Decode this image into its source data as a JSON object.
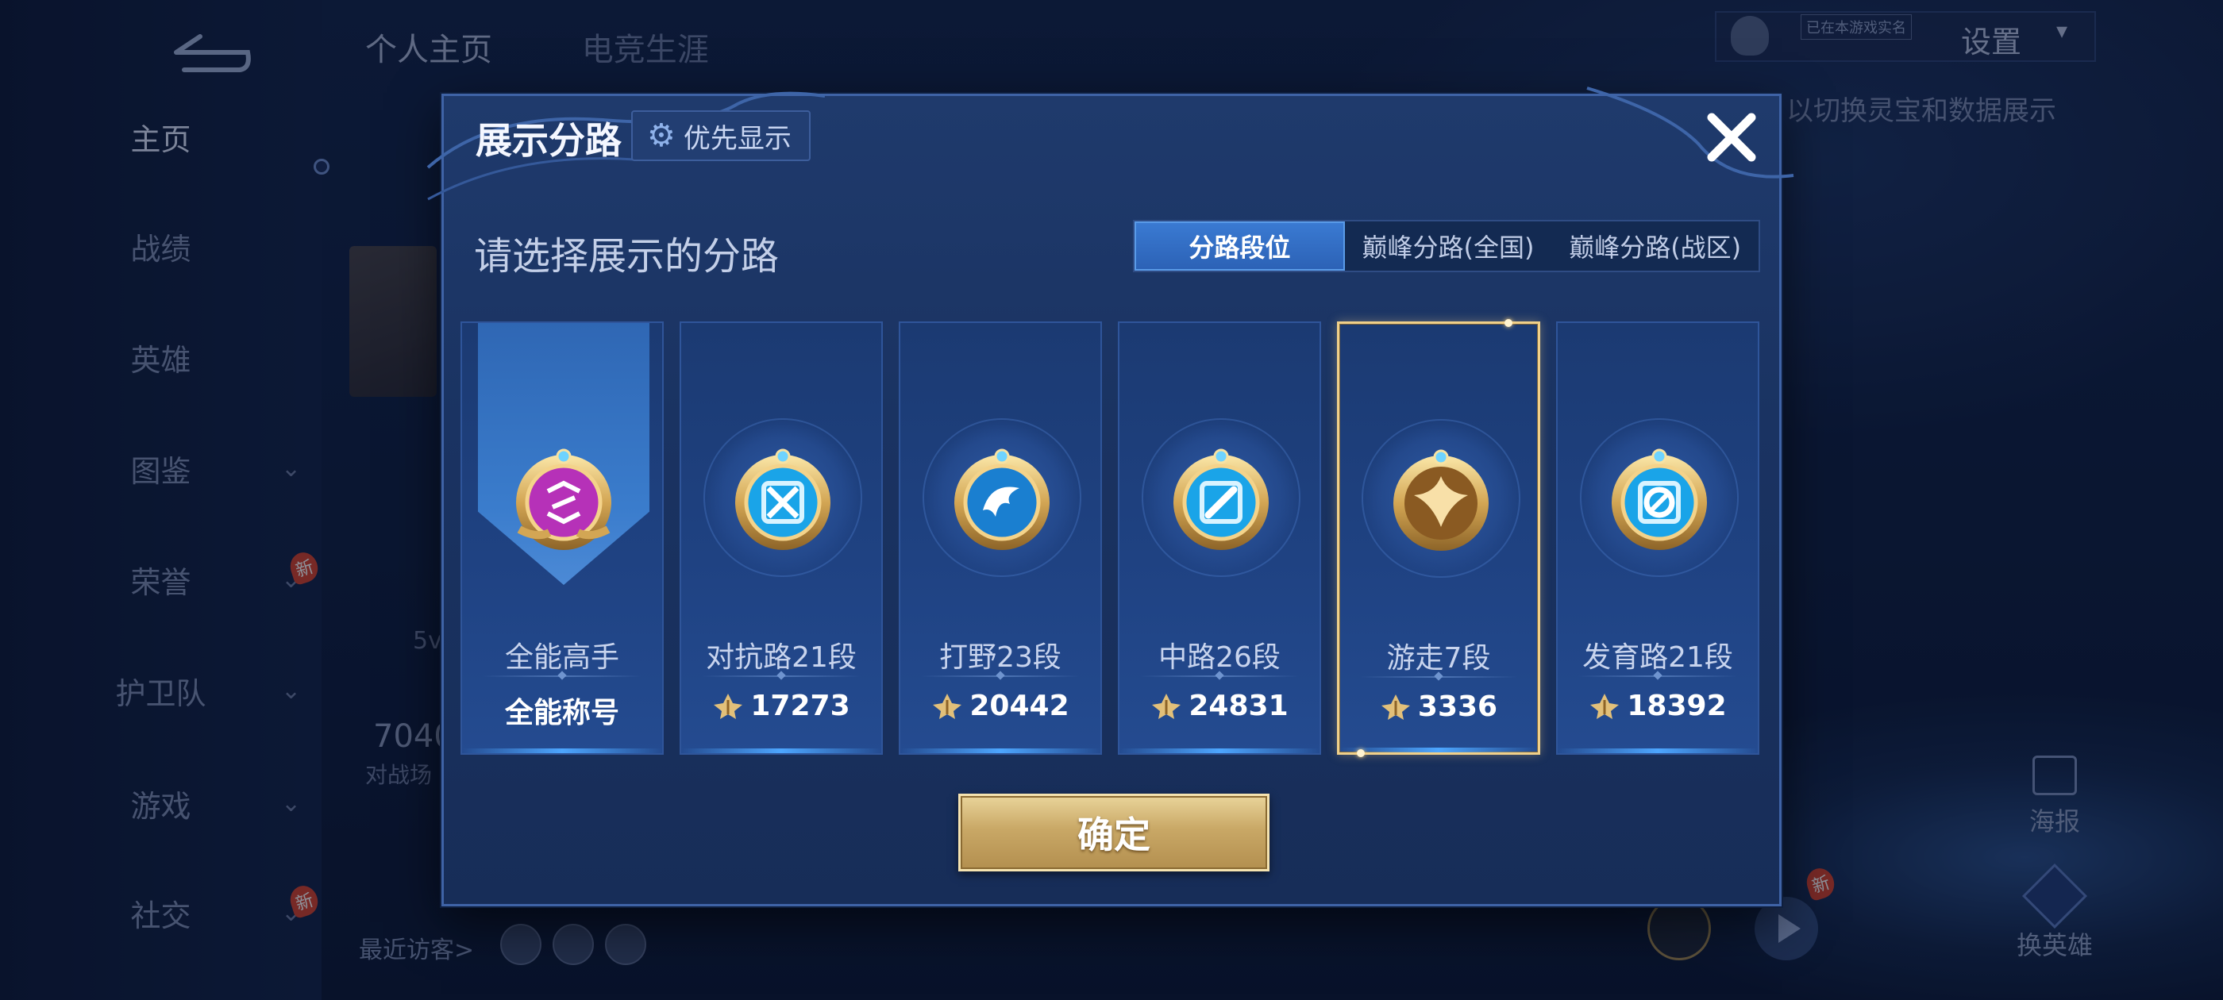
{
  "background": {
    "tabs": [
      "个人主页",
      "电竞生涯"
    ],
    "nav": [
      {
        "label": "主页",
        "active": true,
        "chevron": false,
        "new": false
      },
      {
        "label": "战绩",
        "active": false,
        "chevron": false,
        "new": false
      },
      {
        "label": "英雄",
        "active": false,
        "chevron": false,
        "new": false
      },
      {
        "label": "图鉴",
        "active": false,
        "chevron": true,
        "new": false
      },
      {
        "label": "荣誉",
        "active": false,
        "chevron": true,
        "new": true
      },
      {
        "label": "护卫队",
        "active": false,
        "chevron": true,
        "new": false
      },
      {
        "label": "游戏",
        "active": false,
        "chevron": true,
        "new": false
      },
      {
        "label": "社交",
        "active": false,
        "chevron": true,
        "new": true
      }
    ],
    "new_badge": "新",
    "settings": "设置",
    "small_badge": "已在本游戏实名",
    "hint": "以切换灵宝和数据展示",
    "stat_number": "7040",
    "stat_sub": "对战场",
    "stat_small": "5v",
    "recent_visitors": "最近访客>",
    "poster": "海报",
    "swap_hero": "换英雄"
  },
  "modal": {
    "title": "展示分路",
    "priority_button": "优先显示",
    "subtitle": "请选择展示的分路",
    "tabs": [
      {
        "label": "分路段位",
        "active": true
      },
      {
        "label": "巅峰分路(全国)",
        "active": false
      },
      {
        "label": "巅峰分路(战区)",
        "active": false
      }
    ],
    "cards": [
      {
        "label": "全能高手",
        "value": "全能称号",
        "emblem": "all-round-emblem",
        "selected": false,
        "pennant": true
      },
      {
        "label": "对抗路21段",
        "value": "17273",
        "emblem": "clash-lane-emblem",
        "selected": false
      },
      {
        "label": "打野23段",
        "value": "20442",
        "emblem": "jungle-emblem",
        "selected": false
      },
      {
        "label": "中路26段",
        "value": "24831",
        "emblem": "mid-lane-emblem",
        "selected": false
      },
      {
        "label": "游走7段",
        "value": "3336",
        "emblem": "roam-emblem",
        "selected": true
      },
      {
        "label": "发育路21段",
        "value": "18392",
        "emblem": "farm-lane-emblem",
        "selected": false
      }
    ],
    "confirm": "确定"
  },
  "colors": {
    "accent_gold": "#f0d08a",
    "tab_active": "#3a7ad2",
    "modal_bg": "#1a3362"
  }
}
